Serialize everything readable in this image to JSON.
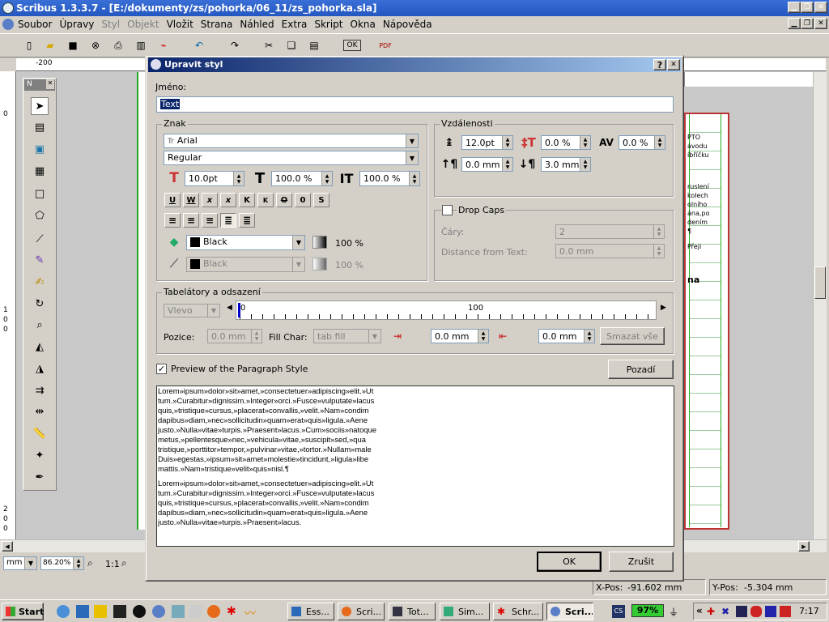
{
  "app": {
    "title": "Scribus 1.3.3.7 - [E:/dokumenty/zs/pohorka/06_11/zs_pohorka.sla]",
    "menu": [
      "Soubor",
      "Úpravy",
      "Styl",
      "Objekt",
      "Vložit",
      "Strana",
      "Náhled",
      "Extra",
      "Skript",
      "Okna",
      "Nápověda"
    ],
    "ruler_label": "-200",
    "unit": "mm",
    "zoom": "86.20%",
    "zoom_1to1": "1:1",
    "xpos_label": "X-Pos:",
    "xpos_value": "-91.602 mm",
    "ypos_label": "Y-Pos:",
    "ypos_value": "-5.304 mm",
    "toolbox_title": "N",
    "side_ruler": [
      "0",
      "1",
      "0",
      "0",
      "2",
      "0",
      "0"
    ]
  },
  "dialog": {
    "title": "Upravit styl",
    "help": "?",
    "close": "✕",
    "name_label": "Jméno:",
    "name_value": "Text",
    "znak": {
      "title": "Znak",
      "font_icon": "Tr",
      "font": "Arial",
      "style": "Regular",
      "size": "10.0pt",
      "scale_w": "100.0 %",
      "scale_h": "100.0 %",
      "effects": [
        "U",
        "W",
        "x",
        "x",
        "K",
        "K",
        "O",
        "0",
        "S"
      ],
      "fill_color": "Black",
      "fill_shade": "100 %",
      "stroke_color": "Black",
      "stroke_shade": "100 %"
    },
    "vzdalenosti": {
      "title": "Vzdálenosti",
      "line_spacing": "12.0pt",
      "baseline_offset": "0.0 %",
      "tracking": "0.0 %",
      "space_before": "0.0 mm",
      "space_after": "3.0 mm"
    },
    "dropcaps": {
      "title": "Drop Caps",
      "lines_label": "Čáry:",
      "lines_value": "2",
      "distance_label": "Distance from Text:",
      "distance_value": "0.0 mm"
    },
    "tabs": {
      "title": "Tabelátory a odsazení",
      "align": "Vlevo",
      "ruler_start": "0",
      "ruler_mid": "100",
      "pos_label": "Pozice:",
      "pos_value": "0.0 mm",
      "fill_label": "Fill Char:",
      "fill_value": "tab fill",
      "first_indent": "0.0 mm",
      "left_indent": "0.0 mm",
      "delete_all": "Smazat vše"
    },
    "preview_label": "Preview of the Paragraph Style",
    "background_button": "Pozadí",
    "preview_text_1": "Lorem»ipsum»dolor»sit»amet,»consectetuer»adipiscing»elit.»Ut\ntum.»Curabitur»dignissim.»Integer»orci.»Fusce»vulputate»lacus\nquis,»tristique»cursus,»placerat»convallis,»velit.»Nam»condim\ndapibus»diam,»nec»sollicitudin»quam»erat»quis»ligula.»Aene\njusto.»Nulla»vitae»turpis.»Praesent»lacus.»Cum»sociis»natoque\nmetus,»pellentesque»nec,»vehicula»vitae,»suscipit»sed,»qua\ntristique,»porttitor»tempor,»pulvinar»vitae,»tortor.»Nullam»male\nDuis»egestas,»ipsum»sit»amet»molestie»tincidunt,»ligula»libe\nmattis.»Nam»tristique»velit»quis»nisl.¶",
    "preview_text_2": "Lorem»ipsum»dolor»sit»amet,»consectetuer»adipiscing»elit.»Ut\ntum.»Curabitur»dignissim.»Integer»orci.»Fusce»vulputate»lacus\nquis,»tristique»cursus,»placerat»convallis,»velit.»Nam»condim\ndapibus»diam,»nec»sollicitudin»quam»erat»quis»ligula.»Aene\njusto.»Nulla»vitae»turpis.»Praesent»lacus.",
    "ok": "OK",
    "cancel": "Zrušit"
  },
  "doc_fragments": [
    "PTO",
    "ávodu",
    "íbříčku",
    "ruslení",
    "kolech",
    "olního",
    "ána,po",
    "dením",
    "¶",
    "Přeji",
    "na"
  ],
  "taskbar": {
    "start": "Start",
    "buttons": [
      "Ess...",
      "Scri...",
      "Tot...",
      "Sim...",
      "Schr...",
      "Scri..."
    ],
    "battery": "97%",
    "cs_badge": "CS",
    "chevron": "«",
    "clock": "7:17"
  }
}
